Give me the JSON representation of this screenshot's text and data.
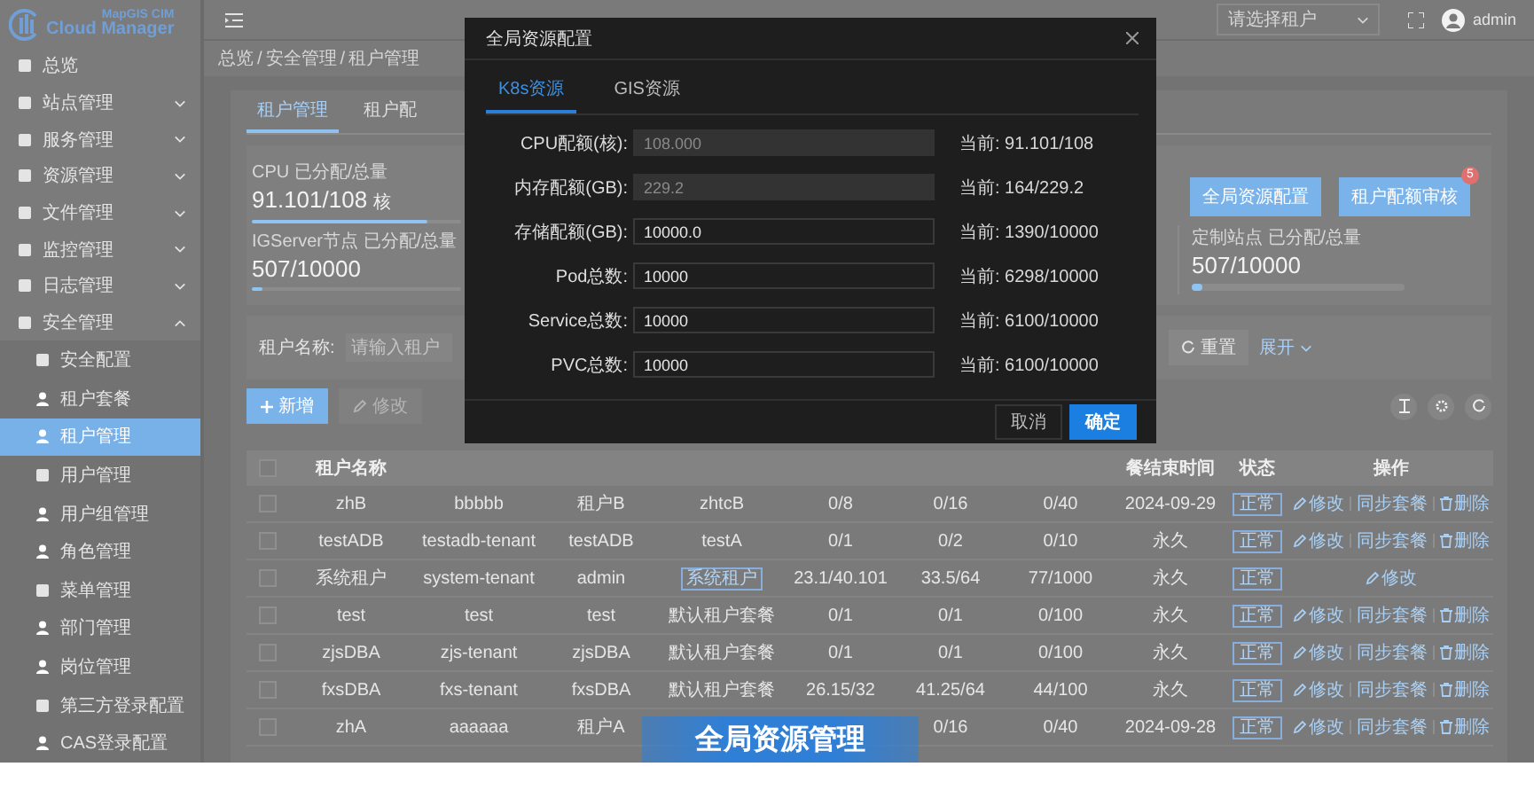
{
  "logo": {
    "top": "MapGIS CIM",
    "bottom": "Cloud Manager"
  },
  "sidebar": {
    "items": [
      {
        "label": "总览",
        "expandable": false,
        "expanded": false
      },
      {
        "label": "站点管理",
        "expandable": true,
        "expanded": false
      },
      {
        "label": "服务管理",
        "expandable": true,
        "expanded": false
      },
      {
        "label": "资源管理",
        "expandable": true,
        "expanded": false
      },
      {
        "label": "文件管理",
        "expandable": true,
        "expanded": false
      },
      {
        "label": "监控管理",
        "expandable": true,
        "expanded": false
      },
      {
        "label": "日志管理",
        "expandable": true,
        "expanded": false
      },
      {
        "label": "安全管理",
        "expandable": true,
        "expanded": true,
        "children": [
          {
            "label": "安全配置",
            "selected": false
          },
          {
            "label": "租户套餐",
            "selected": false
          },
          {
            "label": "租户管理",
            "selected": true
          },
          {
            "label": "用户管理",
            "selected": false
          },
          {
            "label": "用户组管理",
            "selected": false
          },
          {
            "label": "角色管理",
            "selected": false
          },
          {
            "label": "菜单管理",
            "selected": false
          },
          {
            "label": "部门管理",
            "selected": false
          },
          {
            "label": "岗位管理",
            "selected": false
          },
          {
            "label": "第三方登录配置",
            "selected": false
          },
          {
            "label": "CAS登录配置",
            "selected": false
          }
        ]
      }
    ]
  },
  "header": {
    "tenant_select": {
      "placeholder": "请选择租户"
    },
    "user": "admin"
  },
  "breadcrumb": {
    "separator": "/",
    "items": [
      "总览",
      "安全管理",
      "租户管理"
    ]
  },
  "page_tabs": [
    {
      "label": "租户管理",
      "selected": true
    },
    {
      "label": "租户配",
      "selected": false
    }
  ],
  "stats": [
    {
      "label": "CPU 已分配/总量",
      "value": "91.101/108",
      "unit": "核",
      "level": 0.84
    },
    {
      "label": "IGServer节点 已分配/总量",
      "value": "507/10000",
      "level": 0.05
    }
  ],
  "actions": [
    {
      "label": "全局资源配置"
    },
    {
      "label": "租户配额审核",
      "badge": "5"
    }
  ],
  "side_stat": {
    "label": "定制站点 已分配/总量",
    "value": "507/10000",
    "level": 0.05
  },
  "search": {
    "label": "租户名称:",
    "placeholder": "请输入租户",
    "reset": "重置",
    "expand": "展开"
  },
  "toolbar": {
    "add": {
      "label": "新增",
      "disabled": false
    },
    "edit": {
      "label": "修改",
      "disabled": true
    }
  },
  "table": {
    "columns": [
      "租户名称",
      null,
      null,
      null,
      null,
      null,
      null,
      "餐结束时间",
      "状态",
      "操作"
    ],
    "header_checked": false,
    "rows": [
      {
        "checked": false,
        "name": "zhB",
        "column_2": "bbbbb",
        "column_3": "租户B",
        "column_4": {
          "kind": "plain",
          "text": "zhtcB"
        },
        "column_5": "0/8",
        "column_6": "0/16",
        "column_7": "0/40",
        "end_time": "2024-09-29",
        "status": "正常",
        "actions": [
          {
            "kind": "edit",
            "label": "修改"
          },
          {
            "kind": "sync",
            "label": "同步套餐"
          },
          {
            "kind": "delete",
            "label": "删除"
          }
        ]
      },
      {
        "checked": false,
        "name": "testADB",
        "column_2": "testadb-tenant",
        "column_3": "testADB",
        "column_4": {
          "kind": "plain",
          "text": "testA"
        },
        "column_5": "0/1",
        "column_6": "0/2",
        "column_7": "0/10",
        "end_time": "永久",
        "status": "正常",
        "actions": [
          {
            "kind": "edit",
            "label": "修改"
          },
          {
            "kind": "sync",
            "label": "同步套餐"
          },
          {
            "kind": "delete",
            "label": "删除"
          }
        ]
      },
      {
        "checked": false,
        "name": "系统租户",
        "column_2": "system-tenant",
        "column_3": "admin",
        "column_4": {
          "kind": "tag",
          "text": "系统租户"
        },
        "column_5": "23.1/40.101",
        "column_6": "33.5/64",
        "column_7": "77/1000",
        "end_time": "永久",
        "status": "正常",
        "actions": [
          {
            "kind": "edit",
            "label": "修改"
          }
        ]
      },
      {
        "checked": false,
        "name": "test",
        "column_2": "test",
        "column_3": "test",
        "column_4": {
          "kind": "plain",
          "text": "默认租户套餐"
        },
        "column_5": "0/1",
        "column_6": "0/1",
        "column_7": "0/100",
        "end_time": "永久",
        "status": "正常",
        "actions": [
          {
            "kind": "edit",
            "label": "修改"
          },
          {
            "kind": "sync",
            "label": "同步套餐"
          },
          {
            "kind": "delete",
            "label": "删除"
          }
        ]
      },
      {
        "checked": false,
        "name": "zjsDBA",
        "column_2": "zjs-tenant",
        "column_3": "zjsDBA",
        "column_4": {
          "kind": "plain",
          "text": "默认租户套餐"
        },
        "column_5": "0/1",
        "column_6": "0/1",
        "column_7": "0/100",
        "end_time": "永久",
        "status": "正常",
        "actions": [
          {
            "kind": "edit",
            "label": "修改"
          },
          {
            "kind": "sync",
            "label": "同步套餐"
          },
          {
            "kind": "delete",
            "label": "删除"
          }
        ]
      },
      {
        "checked": false,
        "name": "fxsDBA",
        "column_2": "fxs-tenant",
        "column_3": "fxsDBA",
        "column_4": {
          "kind": "plain",
          "text": "默认租户套餐"
        },
        "column_5": "26.15/32",
        "column_6": "41.25/64",
        "column_7": "44/100",
        "end_time": "永久",
        "status": "正常",
        "actions": [
          {
            "kind": "edit",
            "label": "修改"
          },
          {
            "kind": "sync",
            "label": "同步套餐"
          },
          {
            "kind": "delete",
            "label": "删除"
          }
        ]
      },
      {
        "checked": false,
        "name": "zhA",
        "column_2": "aaaaaa",
        "column_3": "租户A",
        "column_4": null,
        "column_5": null,
        "column_6": "0/16",
        "column_7": "0/40",
        "end_time": "2024-09-28",
        "status": "正常",
        "actions": [
          {
            "kind": "edit",
            "label": "修改"
          },
          {
            "kind": "sync",
            "label": "同步套餐"
          },
          {
            "kind": "delete",
            "label": "删除"
          }
        ]
      }
    ]
  },
  "dialog": {
    "title": "全局资源配置",
    "tabs": [
      {
        "label": "K8s资源",
        "selected": true
      },
      {
        "label": "GIS资源",
        "selected": false
      }
    ],
    "fields": [
      {
        "label": "CPU配额(核):",
        "value": "108.000",
        "disabled": true,
        "current": "当前: 91.101/108"
      },
      {
        "label": "内存配额(GB):",
        "value": "229.2",
        "disabled": true,
        "current": "当前: 164/229.2"
      },
      {
        "label": "存储配额(GB):",
        "value": "10000.0",
        "disabled": false,
        "current": "当前: 1390/10000"
      },
      {
        "label": "Pod总数:",
        "value": "10000",
        "disabled": false,
        "current": "当前: 6298/10000"
      },
      {
        "label": "Service总数:",
        "value": "10000",
        "disabled": false,
        "current": "当前: 6100/10000"
      },
      {
        "label": "PVC总数:",
        "value": "10000",
        "disabled": false,
        "current": "当前: 6100/10000"
      }
    ],
    "cancel": "取消",
    "confirm": "确定"
  },
  "banner": {
    "text": "全局资源管理"
  }
}
